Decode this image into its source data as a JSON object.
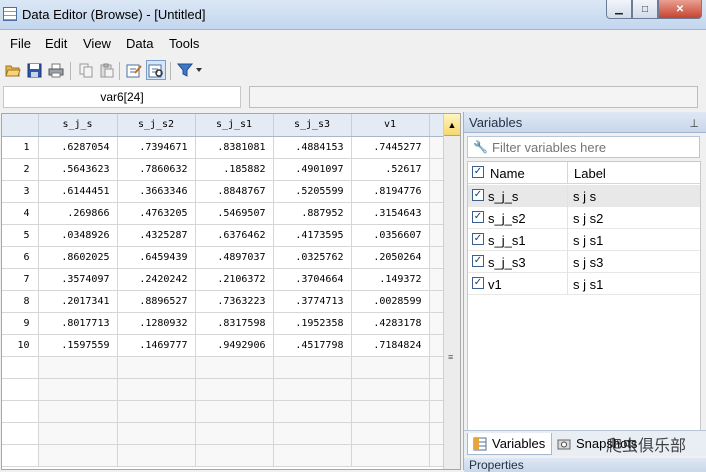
{
  "window": {
    "title": "Data Editor (Browse) - [Untitled]",
    "minimize": "▁",
    "maximize": "□",
    "close": "✕"
  },
  "menu": [
    "File",
    "Edit",
    "View",
    "Data",
    "Tools"
  ],
  "toolbar_icons": [
    "open-folder-icon",
    "save-icon",
    "print-icon",
    "copy-icon",
    "paste-icon",
    "edit-mode-icon",
    "browse-mode-icon",
    "filter-icon"
  ],
  "cell_reference": "var6[24]",
  "cell_value": "",
  "grid": {
    "columns": [
      "s_j_s",
      "s_j_s2",
      "s_j_s1",
      "s_j_s3",
      "v1"
    ],
    "rows": [
      [
        "1",
        ".6287054",
        ".7394671",
        ".8381081",
        ".4884153",
        ".7445277"
      ],
      [
        "2",
        ".5643623",
        ".7860632",
        ".185882",
        ".4901097",
        ".52617"
      ],
      [
        "3",
        ".6144451",
        ".3663346",
        ".8848767",
        ".5205599",
        ".8194776"
      ],
      [
        "4",
        ".269866",
        ".4763205",
        ".5469507",
        ".887952",
        ".3154643"
      ],
      [
        "5",
        ".0348926",
        ".4325287",
        ".6376462",
        ".4173595",
        ".0356607"
      ],
      [
        "6",
        ".8602025",
        ".6459439",
        ".4897037",
        ".0325762",
        ".2050264"
      ],
      [
        "7",
        ".3574097",
        ".2420242",
        ".2106372",
        ".3704664",
        ".149372"
      ],
      [
        "8",
        ".2017341",
        ".8896527",
        ".7363223",
        ".3774713",
        ".0028599"
      ],
      [
        "9",
        ".8017713",
        ".1280932",
        ".8317598",
        ".1952358",
        ".4283178"
      ],
      [
        "10",
        ".1597559",
        ".1469777",
        ".9492906",
        ".4517798",
        ".7184824"
      ]
    ]
  },
  "variables_panel": {
    "title": "Variables",
    "pin": "📌",
    "filter_placeholder": "Filter variables here",
    "col_name": "Name",
    "col_label": "Label",
    "items": [
      {
        "name": "s_j_s",
        "label": "s j s"
      },
      {
        "name": "s_j_s2",
        "label": "s j s2"
      },
      {
        "name": "s_j_s1",
        "label": "s j s1"
      },
      {
        "name": "s_j_s3",
        "label": "s j s3"
      },
      {
        "name": "v1",
        "label": "s j s1"
      }
    ],
    "tab_variables": "Variables",
    "tab_snapshots": "Snapshots",
    "properties_title": "Properties"
  },
  "watermark": "爬虫俱乐部"
}
